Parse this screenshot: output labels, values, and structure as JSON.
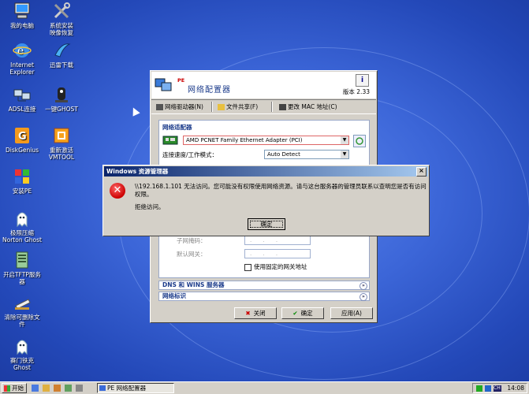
{
  "desktop": {
    "icons": [
      {
        "label": "我的电脑",
        "icon": "computer-icon"
      },
      {
        "label": "系统安装\n映像恢复",
        "icon": "tools-icon"
      },
      {
        "label": "Internet\nExplorer",
        "icon": "ie-icon"
      },
      {
        "label": "迅雷下载",
        "icon": "thunder-icon"
      },
      {
        "label": "ADSL连接",
        "icon": "network-icon"
      },
      {
        "label": "一键GHOST",
        "icon": "ghost-icon"
      },
      {
        "label": "DiskGenius",
        "icon": "diskgenius-icon"
      },
      {
        "label": "重新激活\nVMTOOL",
        "icon": "vmtool-icon"
      },
      {
        "label": "安装PE",
        "icon": "install-pe-icon"
      },
      {
        "label": "极限压缩\nNorton Ghost",
        "icon": "ghost-icon"
      },
      {
        "label": "开启TFTP服务\n器",
        "icon": "tftp-icon"
      },
      {
        "label": "清除可删除文\n件",
        "icon": "clean-icon"
      },
      {
        "label": "赛门铁克\nGhost",
        "icon": "ghost-icon"
      }
    ]
  },
  "taskbar": {
    "start_label": "开始",
    "task_label": "PE 网络配置器",
    "clock": "14:08",
    "tray_ch": "CH"
  },
  "netwin": {
    "pe_tag": "PE",
    "title": "网络配置器",
    "version": "版本 2.33",
    "info_glyph": "i",
    "toolbar": {
      "driver": "网络驱动器(N)",
      "share": "文件共享(F)",
      "mac": "更改 MAC 地址(C)"
    },
    "adapter_section": "网络适配器",
    "adapter_value": "AMD PCNET Family Ethernet Adapter (PCI)",
    "speed_label": "连接速度/工作模式：",
    "speed_value": "Auto Detect",
    "subnet_label": "子网掩码：",
    "gateway_label": "默认网关：",
    "ip_placeholder": ". . .",
    "fixed_gateway_label": "使用固定的网关地址",
    "dns_section": "DNS 和 WINS 服务器",
    "netid_section": "网络标识",
    "buttons": {
      "close": "关闭",
      "ok": "确定",
      "apply": "应用(A)"
    }
  },
  "error_dialog": {
    "title": "Windows 资源管理器",
    "message": "\\\\192.168.1.101 无法访问。您可能没有权限使用网络资源。请与这台服务器的管理员联系以查明您是否有访问权限。",
    "detail": "拒绝访问。",
    "ok": "确定"
  }
}
